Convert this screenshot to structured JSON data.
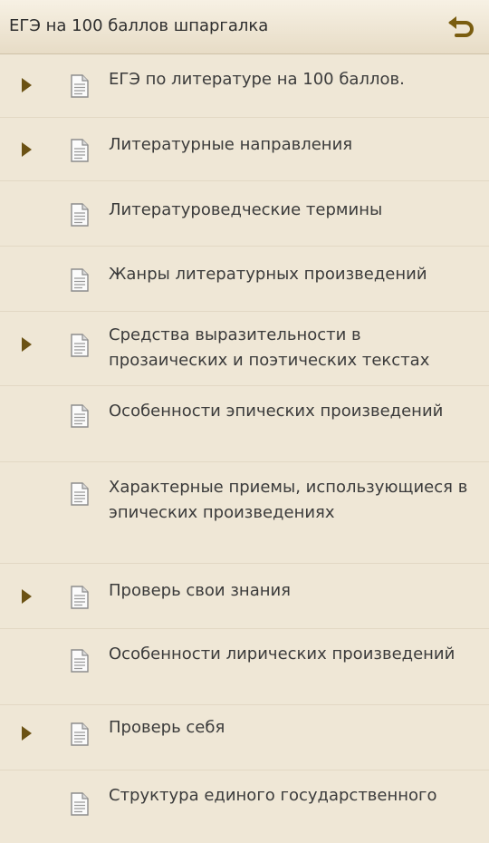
{
  "header": {
    "title": "ЕГЭ на 100 баллов шпаргалка",
    "back_icon": "back-arrow-icon"
  },
  "colors": {
    "background": "#efe7d6",
    "arrow": "#6b5214",
    "back_icon": "#7a5d10"
  },
  "items": [
    {
      "label": "ЕГЭ по литературе на 100 баллов.",
      "has_children": true
    },
    {
      "label": "Литературные направления",
      "has_children": true
    },
    {
      "label": "Литературоведческие термины",
      "has_children": false
    },
    {
      "label": "Жанры литературных произведений",
      "has_children": false
    },
    {
      "label": "Средства выразительности в прозаических и поэтических текстах",
      "has_children": true
    },
    {
      "label": "Особенности эпических произведений",
      "has_children": false
    },
    {
      "label": "Характерные приемы, использующиеся в эпических произведениях",
      "has_children": false
    },
    {
      "label": "Проверь свои знания",
      "has_children": true
    },
    {
      "label": "Особенности лирических произведений",
      "has_children": false
    },
    {
      "label": "Проверь себя",
      "has_children": true
    },
    {
      "label": "Структура единого государственного",
      "has_children": false
    }
  ]
}
